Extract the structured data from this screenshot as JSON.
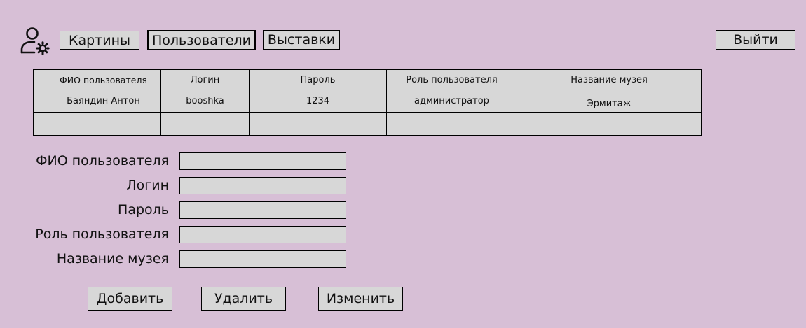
{
  "header": {
    "user_icon": "user-settings-icon",
    "nav": [
      {
        "label": "Картины",
        "active": false
      },
      {
        "label": "Пользователи",
        "active": true
      },
      {
        "label": "Выставки",
        "active": false
      }
    ],
    "logout_label": "Выйти"
  },
  "table": {
    "columns": [
      "ФИО пользователя",
      "Логин",
      "Пароль",
      "Роль пользователя",
      "Название музея"
    ],
    "rows": [
      [
        "Баяндин Антон",
        "booshka",
        "1234",
        "администратор",
        "Эрмитаж"
      ],
      [
        "",
        "",
        "",
        "",
        ""
      ]
    ]
  },
  "form": {
    "fields": [
      {
        "label": "ФИО пользователя",
        "value": ""
      },
      {
        "label": "Логин",
        "value": ""
      },
      {
        "label": "Пароль",
        "value": ""
      },
      {
        "label": "Роль пользователя",
        "value": ""
      },
      {
        "label": "Название музея",
        "value": ""
      }
    ]
  },
  "actions": {
    "add_label": "Добавить",
    "delete_label": "Удалить",
    "edit_label": "Изменить"
  },
  "colors": {
    "background": "#d7bfd6",
    "control": "#d7d7d7",
    "border": "#000000"
  }
}
